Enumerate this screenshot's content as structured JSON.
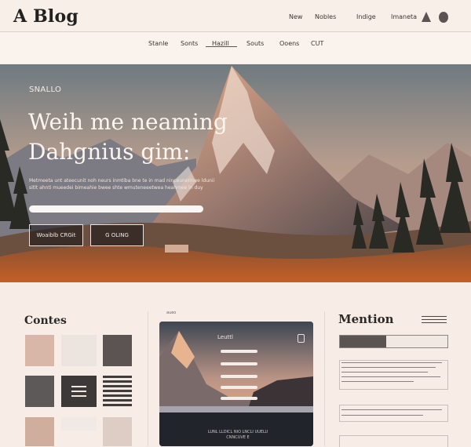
{
  "header": {
    "brand": "A Blog",
    "nav": [
      "New",
      "Nobles",
      "Indige",
      "Imaneta"
    ],
    "nav_icons": [
      "triangle-icon",
      "circle-icon"
    ]
  },
  "subnav": {
    "items": [
      "Stanle",
      "Sonts",
      "Hazill",
      "Souts",
      "Ooens",
      "CUT"
    ],
    "active_index": 2
  },
  "hero": {
    "eyebrow": "SNALLO",
    "title_line1": "Weih me neaming",
    "title_line2": "Dahgnius gim:",
    "description": "Metmeeta unt ateecunit noh neurs inmtiba bne te in mad ninceunerinee ldunii sitlt ahnti mueedei bimeahie bwee shte wmuteneeetwea heahmee ln duy",
    "input_placeholder": "",
    "primary_button": "Woaiblb CRGit",
    "secondary_button": "G OLING"
  },
  "contents": {
    "title": "Contes",
    "swatches": [
      "#d8b7a8",
      "#ece4df",
      "#5b5452",
      "#5d5958",
      "#3c3938",
      "#3f3c3b",
      "#cfae9d",
      "#f0e9e5",
      "#ddcdc5"
    ]
  },
  "panel": {
    "caption": "aueo",
    "label": "Leuttl",
    "text": "LUNL   LLDICL   NIO LNCLI   UUELU   CNNCUVE   E"
  },
  "mention": {
    "title": "Mention",
    "progress": 0.43
  }
}
